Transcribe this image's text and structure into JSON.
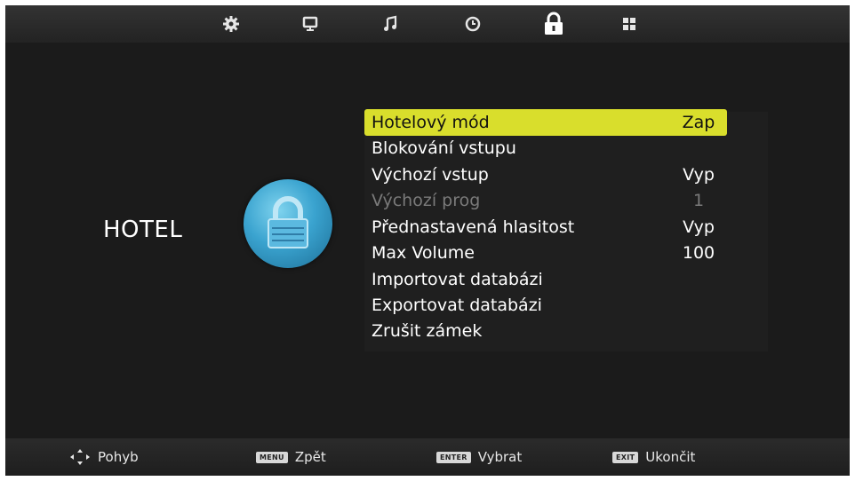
{
  "top_tabs": [
    {
      "icon": "gear-icon",
      "active": false
    },
    {
      "icon": "monitor-icon",
      "active": false
    },
    {
      "icon": "music-note-icon",
      "active": false
    },
    {
      "icon": "clock-icon",
      "active": false
    },
    {
      "icon": "lock-icon",
      "active": true
    },
    {
      "icon": "grid-icon",
      "active": false
    }
  ],
  "section": {
    "title": "HOTEL",
    "icon": "padlock-icon"
  },
  "menu": {
    "items": [
      {
        "label": "Hotelový mód",
        "value": "Zap",
        "state": "selected"
      },
      {
        "label": "Blokování vstupu",
        "value": "",
        "state": "normal"
      },
      {
        "label": "Výchozí vstup",
        "value": "Vyp",
        "state": "normal"
      },
      {
        "label": "Výchozí prog",
        "value": "1",
        "state": "disabled"
      },
      {
        "label": "Přednastavená hlasitost",
        "value": "Vyp",
        "state": "normal"
      },
      {
        "label": "Max Volume",
        "value": "100",
        "state": "normal"
      },
      {
        "label": "Importovat databázi",
        "value": "",
        "state": "normal"
      },
      {
        "label": "Exportovat databázi",
        "value": "",
        "state": "normal"
      },
      {
        "label": "Zrušit zámek",
        "value": "",
        "state": "normal"
      }
    ]
  },
  "footer": {
    "move_label": "Pohyb",
    "menu_key": "MENU",
    "back_label": "Zpět",
    "enter_key": "ENTER",
    "select_label": "Vybrat",
    "exit_key": "EXIT",
    "exit_label": "Ukončit"
  },
  "colors": {
    "background": "#1b1b1b",
    "highlight": "#d9de2c",
    "disabled_text": "#7a7a7a",
    "badge_blue": "#3aa3cf"
  }
}
